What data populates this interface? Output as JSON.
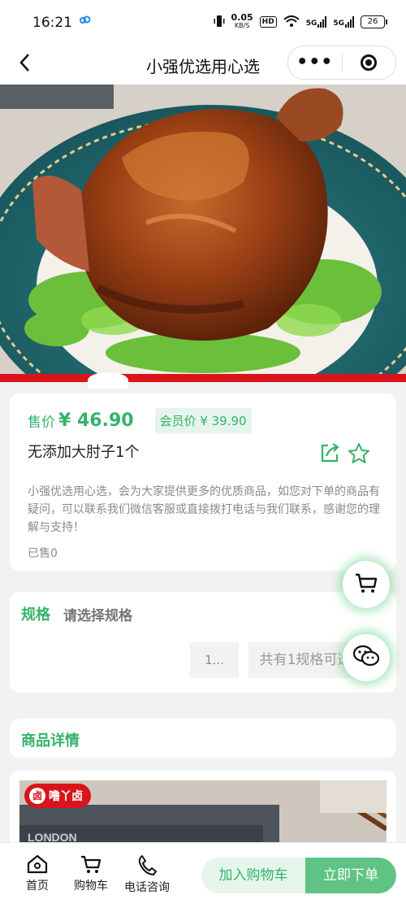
{
  "status_bar": {
    "time": "16:21",
    "net_speed_value": "0.05",
    "net_speed_unit": "KB/S",
    "hd_label": "HD",
    "sim1": "5G",
    "sim2": "5G",
    "battery": "26",
    "cloud_icon": "cloud-sync-icon"
  },
  "nav": {
    "title": "小强优选用心选",
    "back_icon": "chevron-left-icon",
    "more_icon": "more-dots-icon",
    "close_icon": "target-icon"
  },
  "product": {
    "price_label": "售价",
    "price": "¥ 46.90",
    "member_price": "会员价 ¥ 39.90",
    "name": "无添加大肘子1个",
    "description": "小强优选用心选，会为大家提供更多的优质商品，如您对下单的商品有疑问，可以联系我们微信客服或直接拨打电话与我们联系，感谢您的理解与支持！",
    "sold": "已售0"
  },
  "spec": {
    "title": "规格",
    "hint": "请选择规格",
    "option_short": "1...",
    "option_count": "共有1规格可选"
  },
  "detail": {
    "title": "商品详情",
    "brand": "噜丫卤"
  },
  "bottom_nav": {
    "home": "首页",
    "cart": "购物车",
    "phone": "电话咨询",
    "add_to_cart": "加入购物车",
    "buy_now": "立即下单"
  },
  "colors": {
    "accent": "#34b36a",
    "accent_light": "#e6f5ec",
    "buy_button": "#5fc384",
    "brand_red": "#d9141b"
  }
}
